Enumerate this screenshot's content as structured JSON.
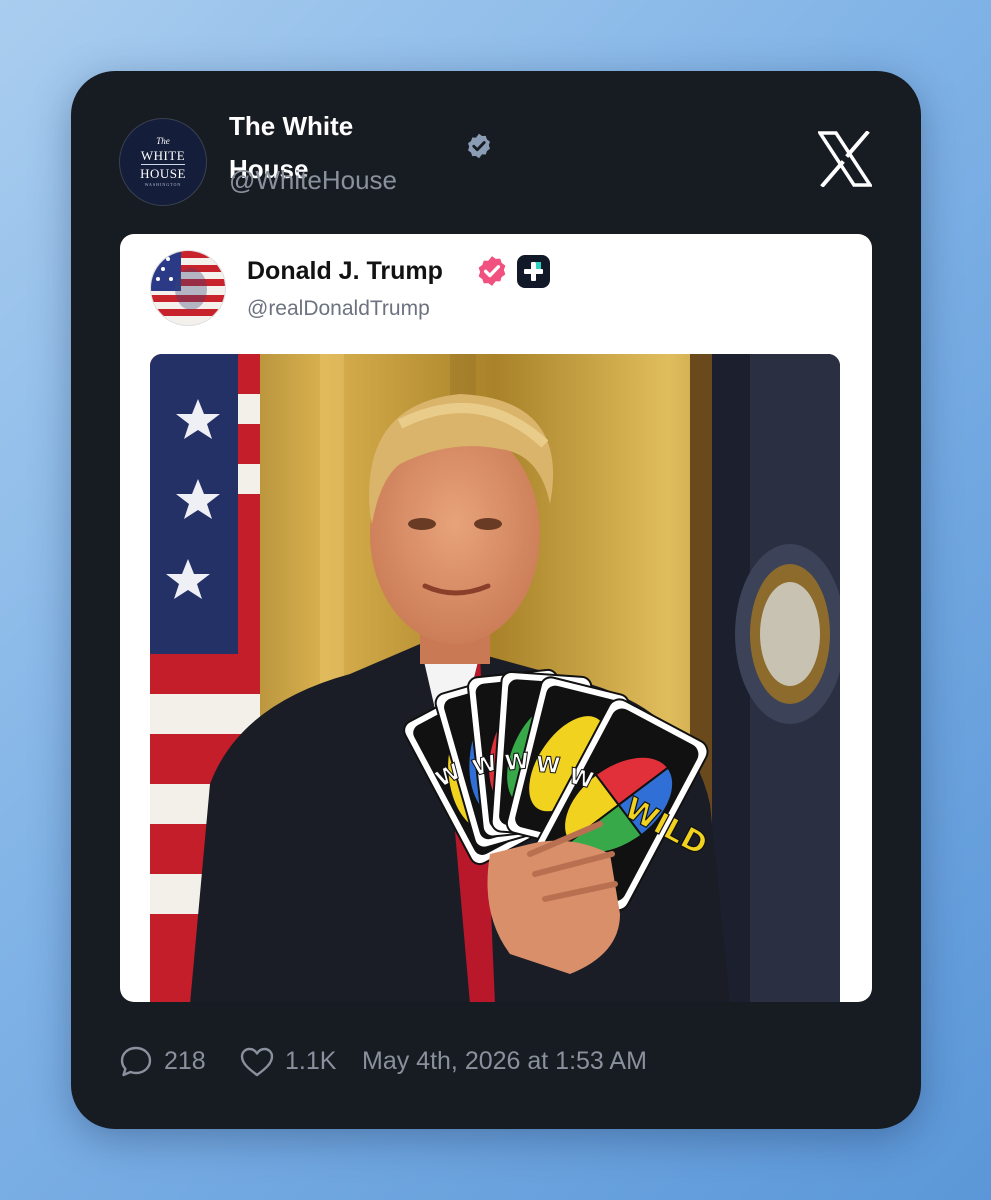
{
  "post": {
    "author_name": "The White House",
    "author_handle": "@WhiteHouse",
    "avatar_logo": {
      "the": "The",
      "line1": "WHITE",
      "line2": "HOUSE",
      "small": "WASHINGTON"
    },
    "verified_badge_color": "#8a9db5"
  },
  "quoted_post": {
    "author_name": "Donald J. Trump",
    "author_handle": "@realDonaldTrump",
    "verified_badge_color": "#f0517f",
    "image": {
      "cards_label": "WILD",
      "card_partial_labels": [
        "W",
        "W",
        "W",
        "W",
        "W"
      ]
    }
  },
  "footer": {
    "reply_count": "218",
    "like_count": "1.1K",
    "timestamp": "May 4th, 2026 at 1:53 AM"
  },
  "icons": [
    "verified-badge-icon",
    "x-logo-icon",
    "subscriber-plus-icon",
    "reply-icon",
    "heart-icon"
  ],
  "colors": {
    "background": "#7fb2e6",
    "card": "#171b22",
    "muted_text": "#8a919d"
  }
}
